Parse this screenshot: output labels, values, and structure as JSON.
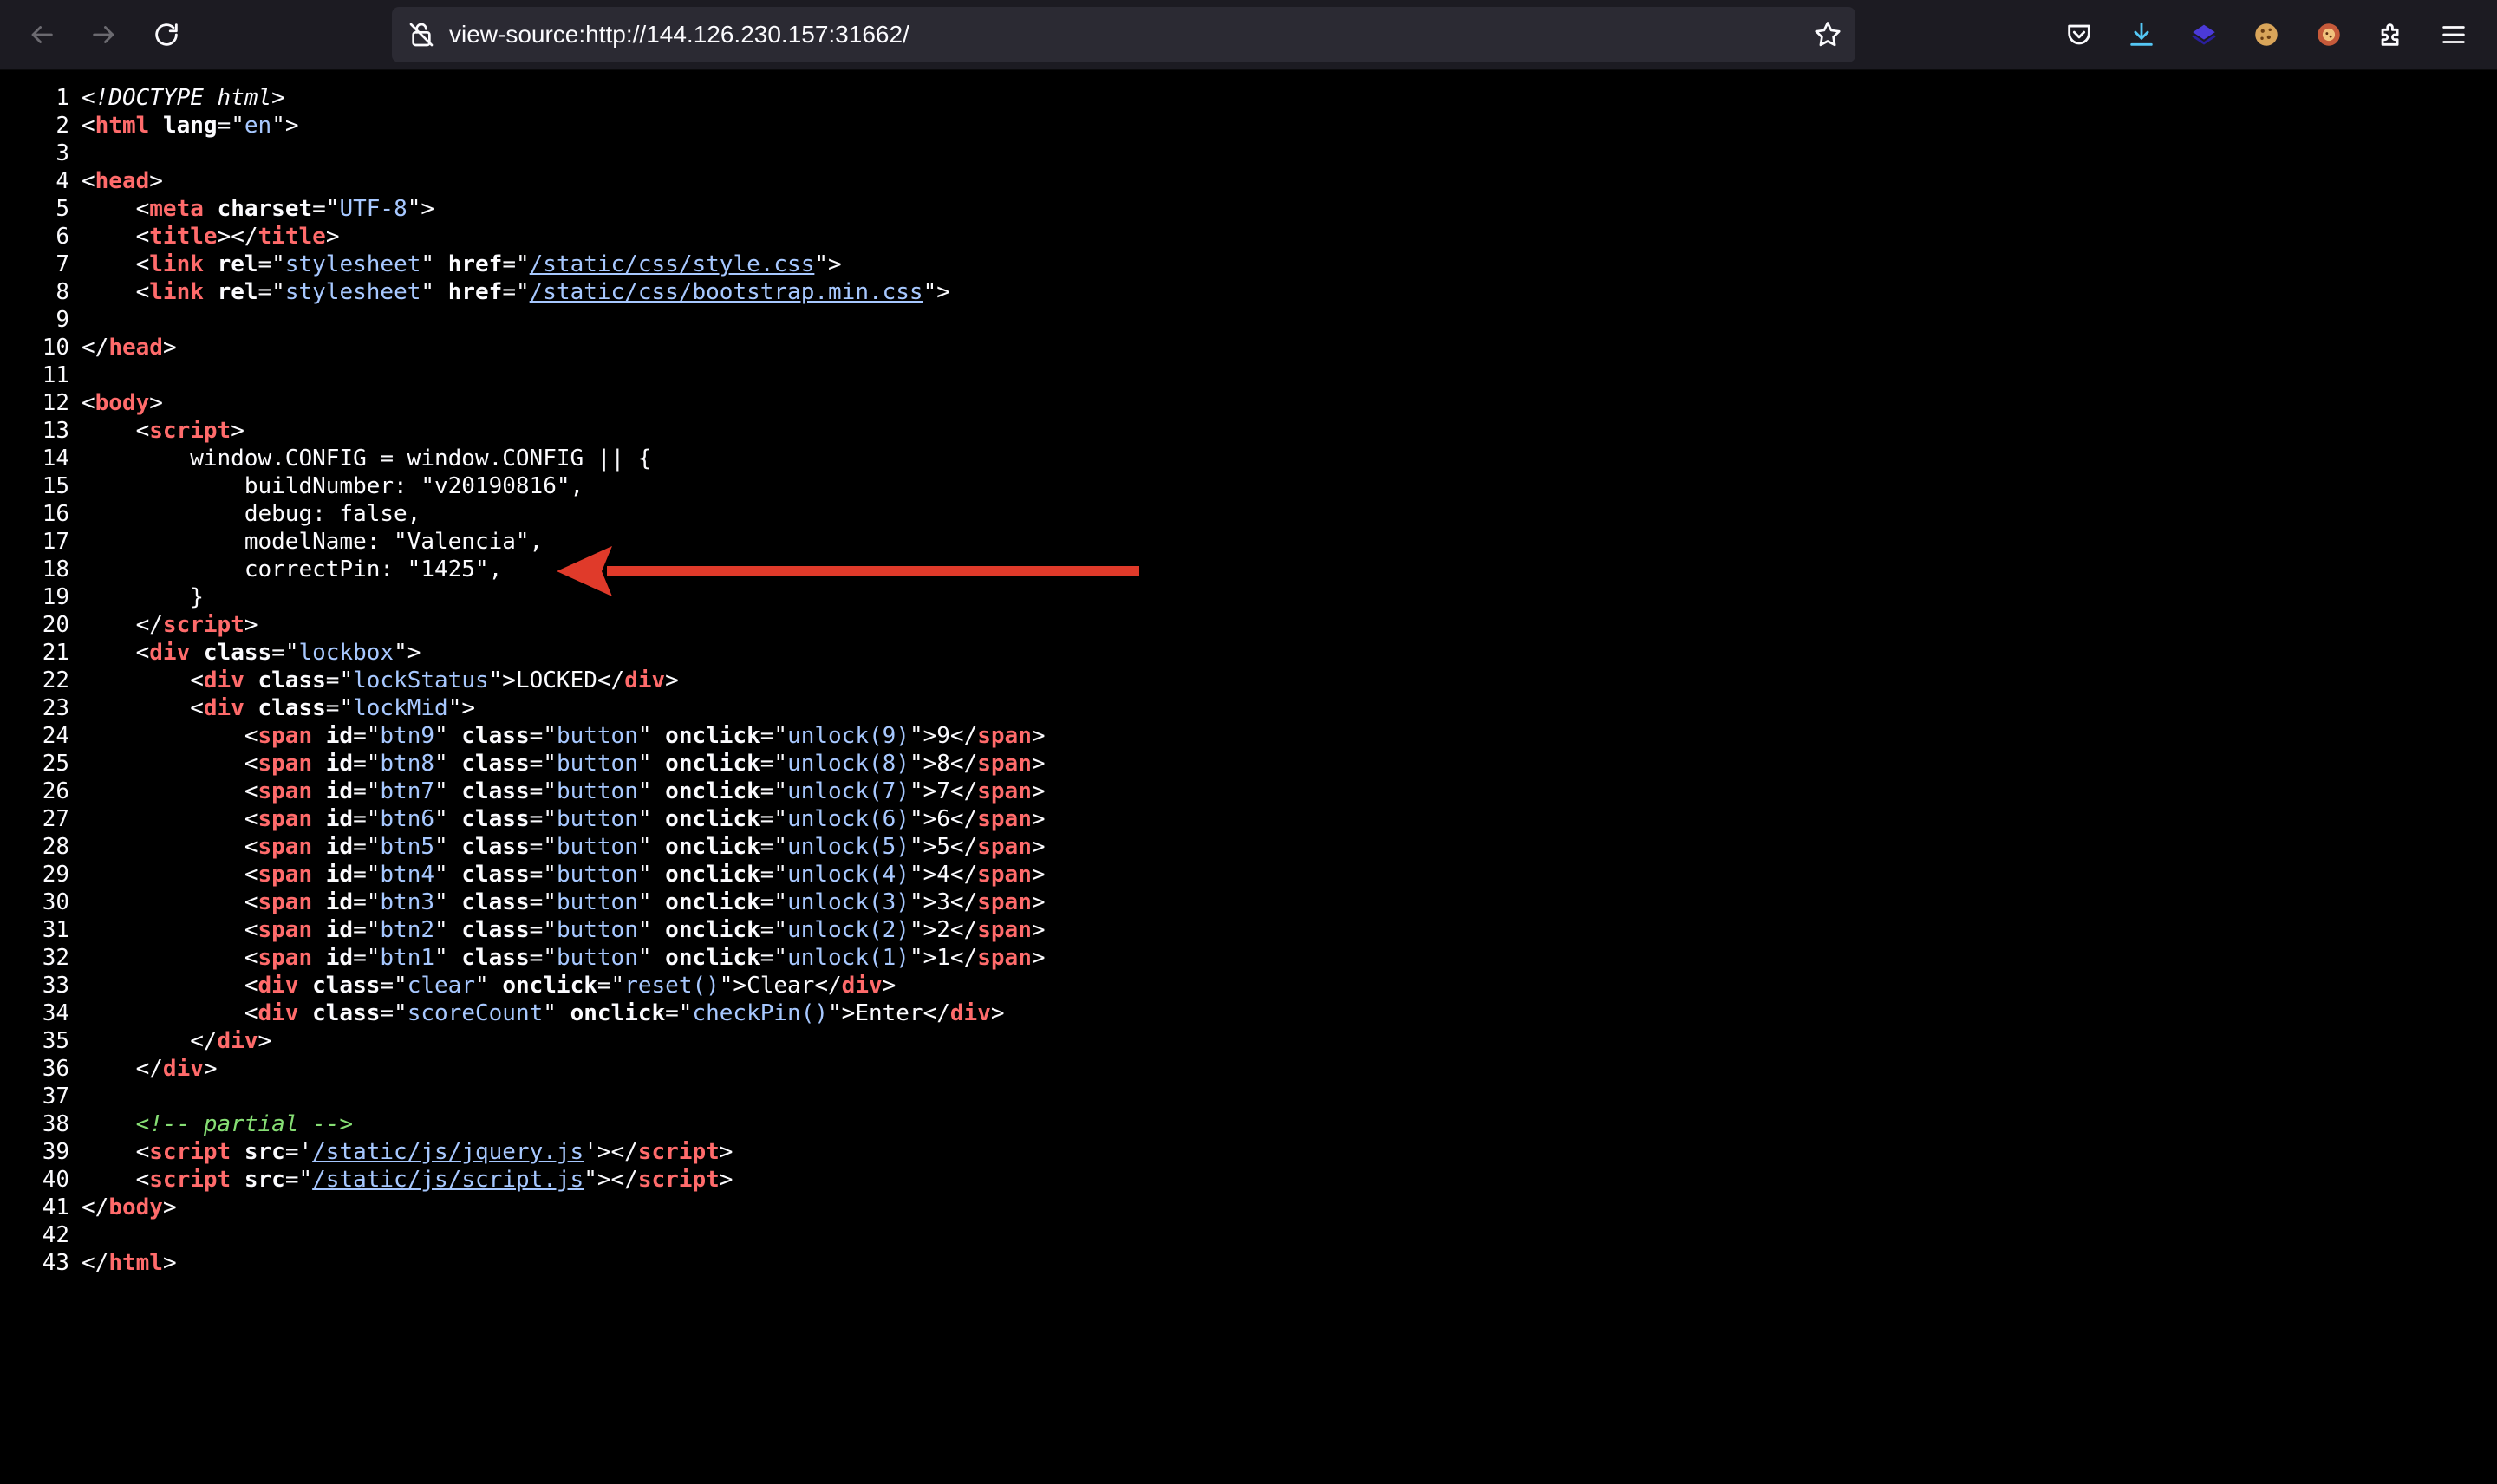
{
  "browser": {
    "url": "view-source:http://144.126.230.157:31662/"
  },
  "colors": {
    "arrow": "#e03a2a",
    "background": "#000000",
    "toolbar": "#1c1b22"
  },
  "source_lines": [
    [
      {
        "c": "dt",
        "t": "<!DOCTYPE html>"
      }
    ],
    [
      {
        "c": "txt",
        "t": "<"
      },
      {
        "c": "tn",
        "t": "html"
      },
      {
        "c": "txt",
        "t": " "
      },
      {
        "c": "an",
        "t": "lang"
      },
      {
        "c": "txt",
        "t": "=\""
      },
      {
        "c": "av",
        "t": "en"
      },
      {
        "c": "txt",
        "t": "\">"
      }
    ],
    [],
    [
      {
        "c": "txt",
        "t": "<"
      },
      {
        "c": "tn",
        "t": "head"
      },
      {
        "c": "txt",
        "t": ">"
      }
    ],
    [
      {
        "c": "txt",
        "t": "    <"
      },
      {
        "c": "tn",
        "t": "meta"
      },
      {
        "c": "txt",
        "t": " "
      },
      {
        "c": "an",
        "t": "charset"
      },
      {
        "c": "txt",
        "t": "=\""
      },
      {
        "c": "av",
        "t": "UTF-8"
      },
      {
        "c": "txt",
        "t": "\">"
      }
    ],
    [
      {
        "c": "txt",
        "t": "    <"
      },
      {
        "c": "tn",
        "t": "title"
      },
      {
        "c": "txt",
        "t": "></"
      },
      {
        "c": "tn",
        "t": "title"
      },
      {
        "c": "txt",
        "t": ">"
      }
    ],
    [
      {
        "c": "txt",
        "t": "    <"
      },
      {
        "c": "tn",
        "t": "link"
      },
      {
        "c": "txt",
        "t": " "
      },
      {
        "c": "an",
        "t": "rel"
      },
      {
        "c": "txt",
        "t": "=\""
      },
      {
        "c": "av",
        "t": "stylesheet"
      },
      {
        "c": "txt",
        "t": "\" "
      },
      {
        "c": "an",
        "t": "href"
      },
      {
        "c": "txt",
        "t": "=\""
      },
      {
        "c": "lnk",
        "t": "/static/css/style.css"
      },
      {
        "c": "txt",
        "t": "\">"
      }
    ],
    [
      {
        "c": "txt",
        "t": "    <"
      },
      {
        "c": "tn",
        "t": "link"
      },
      {
        "c": "txt",
        "t": " "
      },
      {
        "c": "an",
        "t": "rel"
      },
      {
        "c": "txt",
        "t": "=\""
      },
      {
        "c": "av",
        "t": "stylesheet"
      },
      {
        "c": "txt",
        "t": "\" "
      },
      {
        "c": "an",
        "t": "href"
      },
      {
        "c": "txt",
        "t": "=\""
      },
      {
        "c": "lnk",
        "t": "/static/css/bootstrap.min.css"
      },
      {
        "c": "txt",
        "t": "\">"
      }
    ],
    [],
    [
      {
        "c": "txt",
        "t": "</"
      },
      {
        "c": "tn",
        "t": "head"
      },
      {
        "c": "txt",
        "t": ">"
      }
    ],
    [],
    [
      {
        "c": "txt",
        "t": "<"
      },
      {
        "c": "tn",
        "t": "body"
      },
      {
        "c": "txt",
        "t": ">"
      }
    ],
    [
      {
        "c": "txt",
        "t": "    <"
      },
      {
        "c": "tn",
        "t": "script"
      },
      {
        "c": "txt",
        "t": ">"
      }
    ],
    [
      {
        "c": "txt",
        "t": "        window.CONFIG = window.CONFIG || {"
      }
    ],
    [
      {
        "c": "txt",
        "t": "            buildNumber: \"v20190816\","
      }
    ],
    [
      {
        "c": "txt",
        "t": "            debug: false,"
      }
    ],
    [
      {
        "c": "txt",
        "t": "            modelName: \"Valencia\","
      }
    ],
    [
      {
        "c": "txt",
        "t": "            correctPin: \"1425\","
      }
    ],
    [
      {
        "c": "txt",
        "t": "        }"
      }
    ],
    [
      {
        "c": "txt",
        "t": "    </"
      },
      {
        "c": "tn",
        "t": "script"
      },
      {
        "c": "txt",
        "t": ">"
      }
    ],
    [
      {
        "c": "txt",
        "t": "    <"
      },
      {
        "c": "tn",
        "t": "div"
      },
      {
        "c": "txt",
        "t": " "
      },
      {
        "c": "an",
        "t": "class"
      },
      {
        "c": "txt",
        "t": "=\""
      },
      {
        "c": "av",
        "t": "lockbox"
      },
      {
        "c": "txt",
        "t": "\">"
      }
    ],
    [
      {
        "c": "txt",
        "t": "        <"
      },
      {
        "c": "tn",
        "t": "div"
      },
      {
        "c": "txt",
        "t": " "
      },
      {
        "c": "an",
        "t": "class"
      },
      {
        "c": "txt",
        "t": "=\""
      },
      {
        "c": "av",
        "t": "lockStatus"
      },
      {
        "c": "txt",
        "t": "\">LOCKED</"
      },
      {
        "c": "tn",
        "t": "div"
      },
      {
        "c": "txt",
        "t": ">"
      }
    ],
    [
      {
        "c": "txt",
        "t": "        <"
      },
      {
        "c": "tn",
        "t": "div"
      },
      {
        "c": "txt",
        "t": " "
      },
      {
        "c": "an",
        "t": "class"
      },
      {
        "c": "txt",
        "t": "=\""
      },
      {
        "c": "av",
        "t": "lockMid"
      },
      {
        "c": "txt",
        "t": "\">"
      }
    ],
    [
      {
        "c": "txt",
        "t": "            <"
      },
      {
        "c": "tn",
        "t": "span"
      },
      {
        "c": "txt",
        "t": " "
      },
      {
        "c": "an",
        "t": "id"
      },
      {
        "c": "txt",
        "t": "=\""
      },
      {
        "c": "av",
        "t": "btn9"
      },
      {
        "c": "txt",
        "t": "\" "
      },
      {
        "c": "an",
        "t": "class"
      },
      {
        "c": "txt",
        "t": "=\""
      },
      {
        "c": "av",
        "t": "button"
      },
      {
        "c": "txt",
        "t": "\" "
      },
      {
        "c": "an",
        "t": "onclick"
      },
      {
        "c": "txt",
        "t": "=\""
      },
      {
        "c": "av",
        "t": "unlock(9)"
      },
      {
        "c": "txt",
        "t": "\">9</"
      },
      {
        "c": "tn",
        "t": "span"
      },
      {
        "c": "txt",
        "t": ">"
      }
    ],
    [
      {
        "c": "txt",
        "t": "            <"
      },
      {
        "c": "tn",
        "t": "span"
      },
      {
        "c": "txt",
        "t": " "
      },
      {
        "c": "an",
        "t": "id"
      },
      {
        "c": "txt",
        "t": "=\""
      },
      {
        "c": "av",
        "t": "btn8"
      },
      {
        "c": "txt",
        "t": "\" "
      },
      {
        "c": "an",
        "t": "class"
      },
      {
        "c": "txt",
        "t": "=\""
      },
      {
        "c": "av",
        "t": "button"
      },
      {
        "c": "txt",
        "t": "\" "
      },
      {
        "c": "an",
        "t": "onclick"
      },
      {
        "c": "txt",
        "t": "=\""
      },
      {
        "c": "av",
        "t": "unlock(8)"
      },
      {
        "c": "txt",
        "t": "\">8</"
      },
      {
        "c": "tn",
        "t": "span"
      },
      {
        "c": "txt",
        "t": ">"
      }
    ],
    [
      {
        "c": "txt",
        "t": "            <"
      },
      {
        "c": "tn",
        "t": "span"
      },
      {
        "c": "txt",
        "t": " "
      },
      {
        "c": "an",
        "t": "id"
      },
      {
        "c": "txt",
        "t": "=\""
      },
      {
        "c": "av",
        "t": "btn7"
      },
      {
        "c": "txt",
        "t": "\" "
      },
      {
        "c": "an",
        "t": "class"
      },
      {
        "c": "txt",
        "t": "=\""
      },
      {
        "c": "av",
        "t": "button"
      },
      {
        "c": "txt",
        "t": "\" "
      },
      {
        "c": "an",
        "t": "onclick"
      },
      {
        "c": "txt",
        "t": "=\""
      },
      {
        "c": "av",
        "t": "unlock(7)"
      },
      {
        "c": "txt",
        "t": "\">7</"
      },
      {
        "c": "tn",
        "t": "span"
      },
      {
        "c": "txt",
        "t": ">"
      }
    ],
    [
      {
        "c": "txt",
        "t": "            <"
      },
      {
        "c": "tn",
        "t": "span"
      },
      {
        "c": "txt",
        "t": " "
      },
      {
        "c": "an",
        "t": "id"
      },
      {
        "c": "txt",
        "t": "=\""
      },
      {
        "c": "av",
        "t": "btn6"
      },
      {
        "c": "txt",
        "t": "\" "
      },
      {
        "c": "an",
        "t": "class"
      },
      {
        "c": "txt",
        "t": "=\""
      },
      {
        "c": "av",
        "t": "button"
      },
      {
        "c": "txt",
        "t": "\" "
      },
      {
        "c": "an",
        "t": "onclick"
      },
      {
        "c": "txt",
        "t": "=\""
      },
      {
        "c": "av",
        "t": "unlock(6)"
      },
      {
        "c": "txt",
        "t": "\">6</"
      },
      {
        "c": "tn",
        "t": "span"
      },
      {
        "c": "txt",
        "t": ">"
      }
    ],
    [
      {
        "c": "txt",
        "t": "            <"
      },
      {
        "c": "tn",
        "t": "span"
      },
      {
        "c": "txt",
        "t": " "
      },
      {
        "c": "an",
        "t": "id"
      },
      {
        "c": "txt",
        "t": "=\""
      },
      {
        "c": "av",
        "t": "btn5"
      },
      {
        "c": "txt",
        "t": "\" "
      },
      {
        "c": "an",
        "t": "class"
      },
      {
        "c": "txt",
        "t": "=\""
      },
      {
        "c": "av",
        "t": "button"
      },
      {
        "c": "txt",
        "t": "\" "
      },
      {
        "c": "an",
        "t": "onclick"
      },
      {
        "c": "txt",
        "t": "=\""
      },
      {
        "c": "av",
        "t": "unlock(5)"
      },
      {
        "c": "txt",
        "t": "\">5</"
      },
      {
        "c": "tn",
        "t": "span"
      },
      {
        "c": "txt",
        "t": ">"
      }
    ],
    [
      {
        "c": "txt",
        "t": "            <"
      },
      {
        "c": "tn",
        "t": "span"
      },
      {
        "c": "txt",
        "t": " "
      },
      {
        "c": "an",
        "t": "id"
      },
      {
        "c": "txt",
        "t": "=\""
      },
      {
        "c": "av",
        "t": "btn4"
      },
      {
        "c": "txt",
        "t": "\" "
      },
      {
        "c": "an",
        "t": "class"
      },
      {
        "c": "txt",
        "t": "=\""
      },
      {
        "c": "av",
        "t": "button"
      },
      {
        "c": "txt",
        "t": "\" "
      },
      {
        "c": "an",
        "t": "onclick"
      },
      {
        "c": "txt",
        "t": "=\""
      },
      {
        "c": "av",
        "t": "unlock(4)"
      },
      {
        "c": "txt",
        "t": "\">4</"
      },
      {
        "c": "tn",
        "t": "span"
      },
      {
        "c": "txt",
        "t": ">"
      }
    ],
    [
      {
        "c": "txt",
        "t": "            <"
      },
      {
        "c": "tn",
        "t": "span"
      },
      {
        "c": "txt",
        "t": " "
      },
      {
        "c": "an",
        "t": "id"
      },
      {
        "c": "txt",
        "t": "=\""
      },
      {
        "c": "av",
        "t": "btn3"
      },
      {
        "c": "txt",
        "t": "\" "
      },
      {
        "c": "an",
        "t": "class"
      },
      {
        "c": "txt",
        "t": "=\""
      },
      {
        "c": "av",
        "t": "button"
      },
      {
        "c": "txt",
        "t": "\" "
      },
      {
        "c": "an",
        "t": "onclick"
      },
      {
        "c": "txt",
        "t": "=\""
      },
      {
        "c": "av",
        "t": "unlock(3)"
      },
      {
        "c": "txt",
        "t": "\">3</"
      },
      {
        "c": "tn",
        "t": "span"
      },
      {
        "c": "txt",
        "t": ">"
      }
    ],
    [
      {
        "c": "txt",
        "t": "            <"
      },
      {
        "c": "tn",
        "t": "span"
      },
      {
        "c": "txt",
        "t": " "
      },
      {
        "c": "an",
        "t": "id"
      },
      {
        "c": "txt",
        "t": "=\""
      },
      {
        "c": "av",
        "t": "btn2"
      },
      {
        "c": "txt",
        "t": "\" "
      },
      {
        "c": "an",
        "t": "class"
      },
      {
        "c": "txt",
        "t": "=\""
      },
      {
        "c": "av",
        "t": "button"
      },
      {
        "c": "txt",
        "t": "\" "
      },
      {
        "c": "an",
        "t": "onclick"
      },
      {
        "c": "txt",
        "t": "=\""
      },
      {
        "c": "av",
        "t": "unlock(2)"
      },
      {
        "c": "txt",
        "t": "\">2</"
      },
      {
        "c": "tn",
        "t": "span"
      },
      {
        "c": "txt",
        "t": ">"
      }
    ],
    [
      {
        "c": "txt",
        "t": "            <"
      },
      {
        "c": "tn",
        "t": "span"
      },
      {
        "c": "txt",
        "t": " "
      },
      {
        "c": "an",
        "t": "id"
      },
      {
        "c": "txt",
        "t": "=\""
      },
      {
        "c": "av",
        "t": "btn1"
      },
      {
        "c": "txt",
        "t": "\" "
      },
      {
        "c": "an",
        "t": "class"
      },
      {
        "c": "txt",
        "t": "=\""
      },
      {
        "c": "av",
        "t": "button"
      },
      {
        "c": "txt",
        "t": "\" "
      },
      {
        "c": "an",
        "t": "onclick"
      },
      {
        "c": "txt",
        "t": "=\""
      },
      {
        "c": "av",
        "t": "unlock(1)"
      },
      {
        "c": "txt",
        "t": "\">1</"
      },
      {
        "c": "tn",
        "t": "span"
      },
      {
        "c": "txt",
        "t": ">"
      }
    ],
    [
      {
        "c": "txt",
        "t": "            <"
      },
      {
        "c": "tn",
        "t": "div"
      },
      {
        "c": "txt",
        "t": " "
      },
      {
        "c": "an",
        "t": "class"
      },
      {
        "c": "txt",
        "t": "=\""
      },
      {
        "c": "av",
        "t": "clear"
      },
      {
        "c": "txt",
        "t": "\" "
      },
      {
        "c": "an",
        "t": "onclick"
      },
      {
        "c": "txt",
        "t": "=\""
      },
      {
        "c": "av",
        "t": "reset()"
      },
      {
        "c": "txt",
        "t": "\">Clear</"
      },
      {
        "c": "tn",
        "t": "div"
      },
      {
        "c": "txt",
        "t": ">"
      }
    ],
    [
      {
        "c": "txt",
        "t": "            <"
      },
      {
        "c": "tn",
        "t": "div"
      },
      {
        "c": "txt",
        "t": " "
      },
      {
        "c": "an",
        "t": "class"
      },
      {
        "c": "txt",
        "t": "=\""
      },
      {
        "c": "av",
        "t": "scoreCount"
      },
      {
        "c": "txt",
        "t": "\" "
      },
      {
        "c": "an",
        "t": "onclick"
      },
      {
        "c": "txt",
        "t": "=\""
      },
      {
        "c": "av",
        "t": "checkPin()"
      },
      {
        "c": "txt",
        "t": "\">Enter</"
      },
      {
        "c": "tn",
        "t": "div"
      },
      {
        "c": "txt",
        "t": ">"
      }
    ],
    [
      {
        "c": "txt",
        "t": "        </"
      },
      {
        "c": "tn",
        "t": "div"
      },
      {
        "c": "txt",
        "t": ">"
      }
    ],
    [
      {
        "c": "txt",
        "t": "    </"
      },
      {
        "c": "tn",
        "t": "div"
      },
      {
        "c": "txt",
        "t": ">"
      }
    ],
    [],
    [
      {
        "c": "txt",
        "t": "    "
      },
      {
        "c": "cm",
        "t": "<!-- partial -->"
      }
    ],
    [
      {
        "c": "txt",
        "t": "    <"
      },
      {
        "c": "tn",
        "t": "script"
      },
      {
        "c": "txt",
        "t": " "
      },
      {
        "c": "an",
        "t": "src"
      },
      {
        "c": "txt",
        "t": "='"
      },
      {
        "c": "lnk",
        "t": "/static/js/jquery.js"
      },
      {
        "c": "txt",
        "t": "'></"
      },
      {
        "c": "tn",
        "t": "script"
      },
      {
        "c": "txt",
        "t": ">"
      }
    ],
    [
      {
        "c": "txt",
        "t": "    <"
      },
      {
        "c": "tn",
        "t": "script"
      },
      {
        "c": "txt",
        "t": " "
      },
      {
        "c": "an",
        "t": "src"
      },
      {
        "c": "txt",
        "t": "=\""
      },
      {
        "c": "lnk",
        "t": "/static/js/script.js"
      },
      {
        "c": "txt",
        "t": "\"></"
      },
      {
        "c": "tn",
        "t": "script"
      },
      {
        "c": "txt",
        "t": ">"
      }
    ],
    [
      {
        "c": "txt",
        "t": "</"
      },
      {
        "c": "tn",
        "t": "body"
      },
      {
        "c": "txt",
        "t": ">"
      }
    ],
    [],
    [
      {
        "c": "txt",
        "t": "</"
      },
      {
        "c": "tn",
        "t": "html"
      },
      {
        "c": "txt",
        "t": ">"
      }
    ]
  ]
}
